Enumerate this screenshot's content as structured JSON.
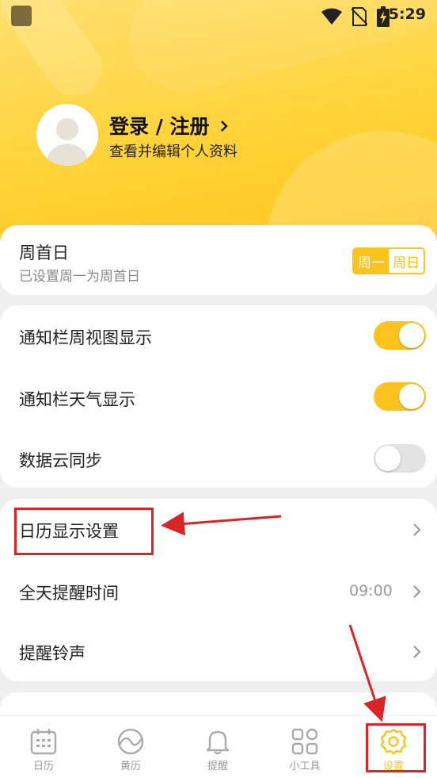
{
  "status_bar": {
    "time": "5:29"
  },
  "profile": {
    "title": "登录 / 注册",
    "subtitle": "查看并编辑个人资料"
  },
  "week_start": {
    "label": "周首日",
    "description": "已设置周一为周首日",
    "option_monday": "周一",
    "option_sunday": "周日",
    "selected": "周一"
  },
  "toggles": [
    {
      "label": "通知栏周视图显示",
      "on": true
    },
    {
      "label": "通知栏天气显示",
      "on": true
    },
    {
      "label": "数据云同步",
      "on": false
    }
  ],
  "nav_items": [
    {
      "label": "日历显示设置"
    },
    {
      "label": "全天提醒时间",
      "value": "09:00"
    },
    {
      "label": "提醒铃声"
    }
  ],
  "tabs": [
    {
      "label": "日历",
      "icon": "calendar-icon"
    },
    {
      "label": "黄历",
      "icon": "almanac-icon"
    },
    {
      "label": "提醒",
      "icon": "bell-icon"
    },
    {
      "label": "小工具",
      "icon": "tools-grid-icon"
    },
    {
      "label": "设置",
      "icon": "gear-icon",
      "active": true
    }
  ],
  "colors": {
    "accent": "#fcc21d",
    "annotation": "#d92525"
  }
}
